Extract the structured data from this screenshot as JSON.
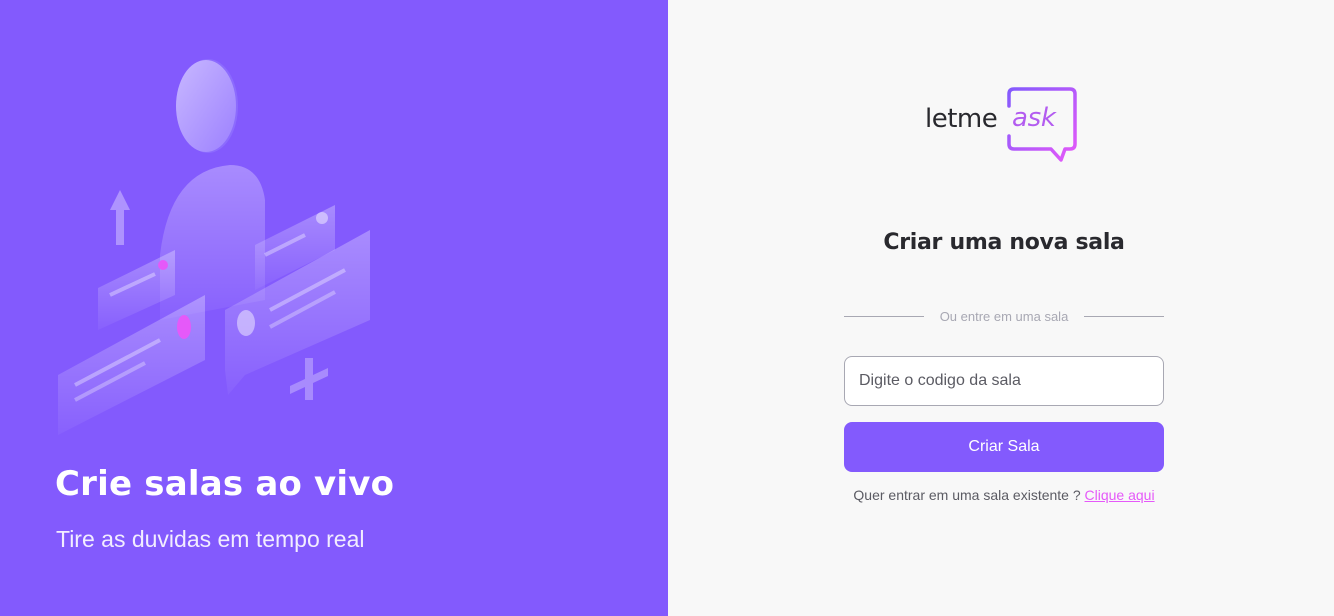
{
  "aside": {
    "illustration_icon": "question-and-answer-illustration",
    "title": "Crie salas ao vivo",
    "subtitle": "Tire as duvidas em tempo real",
    "background_color": "#835afd"
  },
  "main": {
    "logo": {
      "word": "letme",
      "accent_word": "ask",
      "icon": "speech-bubble-icon"
    },
    "heading": "Criar uma nova sala",
    "separator_text": "Ou entre em uma sala",
    "room_input": {
      "placeholder": "Digite o codigo da sala",
      "value": ""
    },
    "create_button_label": "Criar Sala",
    "existing_room_prompt": "Quer entrar em uma sala existente ?",
    "existing_room_link": "Clique aqui",
    "colors": {
      "primary": "#835afd",
      "accent_pink": "#e559f9",
      "text_dark": "#29292e",
      "background": "#f8f8f8"
    }
  }
}
